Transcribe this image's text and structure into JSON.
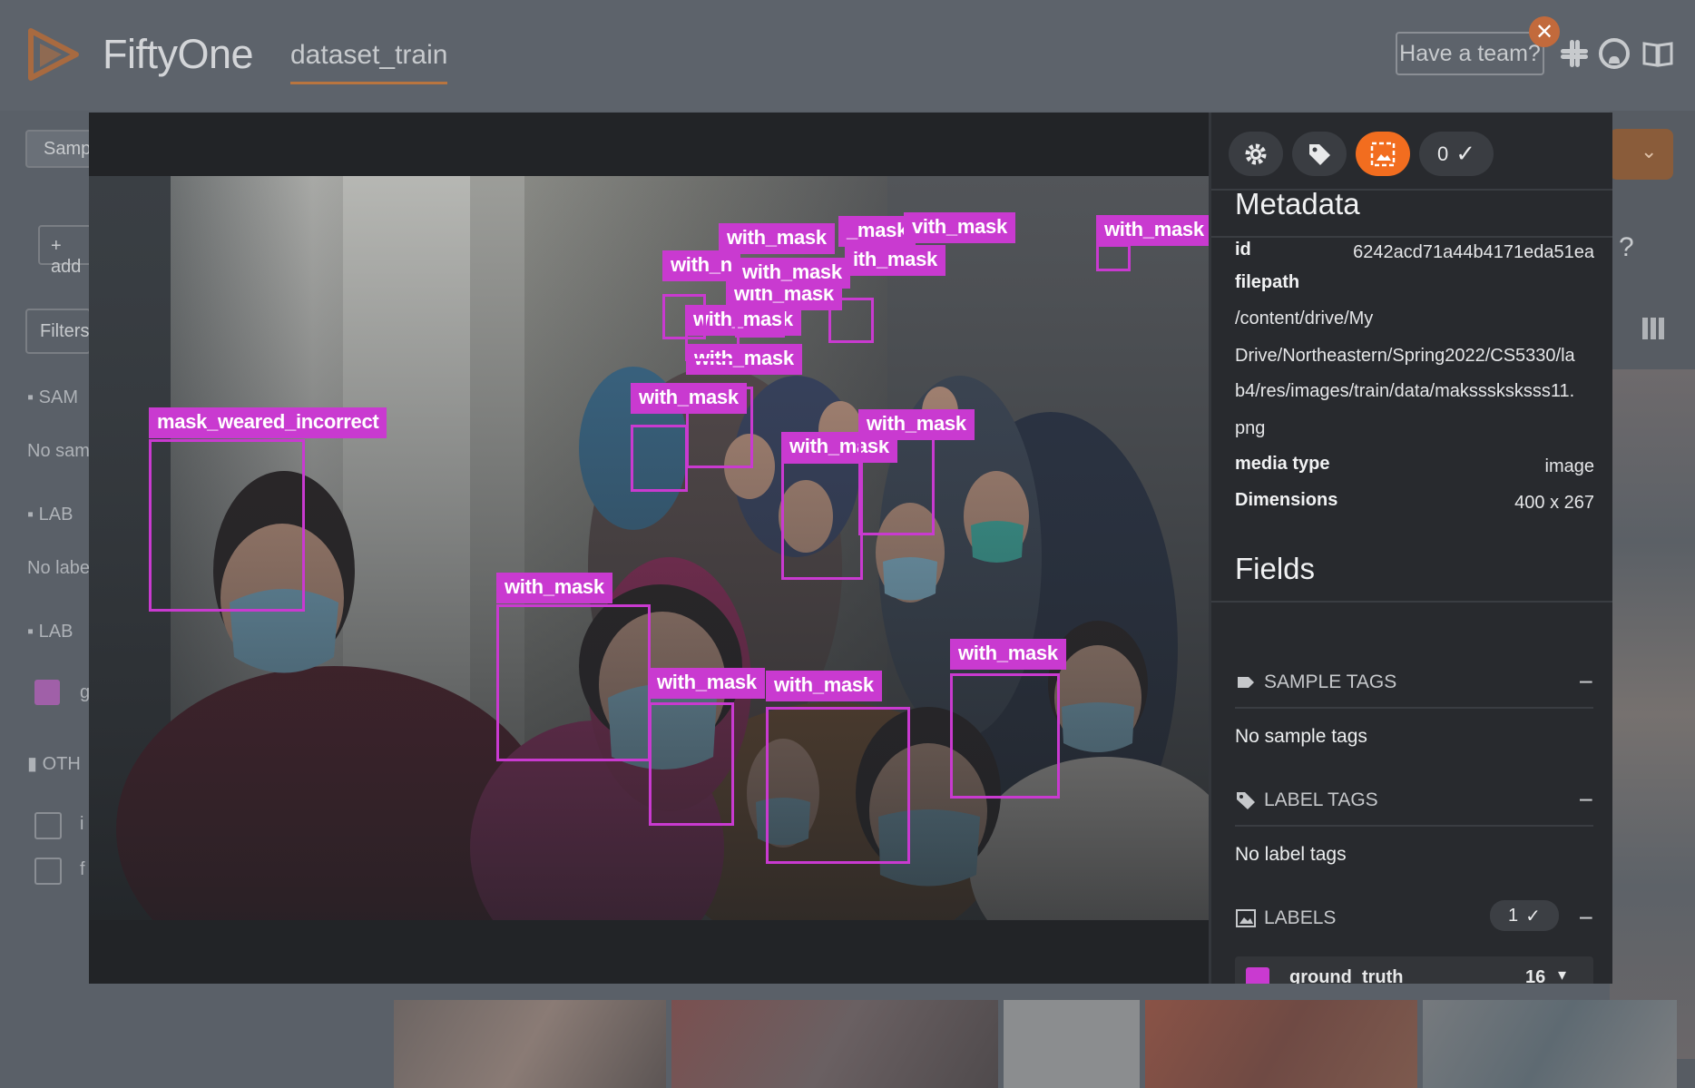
{
  "app": {
    "name": "FiftyOne",
    "dataset_tab": "dataset_train",
    "team_button": "Have a team?",
    "sidebar": {
      "samples_tab": "Samp",
      "add_stage": "+ add",
      "filters": "Filters",
      "sample_tags_header": "SAM",
      "no_sample_tags": "No sam",
      "label_tags_header": "LAB",
      "no_label_tags": "No labe",
      "labels_header": "LAB",
      "labels_item": "g",
      "other_header": "OTH",
      "other_item_1": "i",
      "other_item_2": "f"
    }
  },
  "modal": {
    "toolbar": {
      "settings_icon": "gear-icon",
      "tag_icon": "tag-icon",
      "labels_icon": "image-labels-icon",
      "selected_count": "0"
    },
    "detections": [
      {
        "label": "mask_weared_incorrect"
      },
      {
        "label": "with_mask"
      },
      {
        "label": "with_mask"
      },
      {
        "label": "with_mask"
      },
      {
        "label": "with_mask"
      },
      {
        "label": "with_mask"
      },
      {
        "label": "with_mask"
      },
      {
        "label": "with_mask"
      },
      {
        "label": "with_mask"
      },
      {
        "label": "with_mask"
      },
      {
        "label": "with_mask"
      },
      {
        "label": "with_mask"
      },
      {
        "label": "with_mask"
      },
      {
        "label": "with_n"
      },
      {
        "label": "with_mask"
      },
      {
        "label": "ith_mask"
      },
      {
        "label": "_mask"
      },
      {
        "label": "vith_mask"
      }
    ],
    "panel": {
      "metadata_title": "Metadata",
      "id_key": "id",
      "id_value": "6242acd71a44b4171eda51ea",
      "filepath_key": "filepath",
      "filepath_lines": [
        "/content/drive/My",
        "Drive/Northeastern/Spring2022/CS5330/la",
        "b4/res/images/train/data/maksssksksss11.",
        "png"
      ],
      "media_type_key": "media type",
      "media_type_value": "image",
      "dimensions_key": "Dimensions",
      "dimensions_value": "400 x 267",
      "fields_title": "Fields",
      "sample_tags_label": "SAMPLE TAGS",
      "no_sample_tags": "No sample tags",
      "label_tags_label": "LABEL TAGS",
      "no_label_tags": "No label tags",
      "labels_label": "LABELS",
      "labels_badge": "1",
      "ground_truth_label": "ground_truth",
      "ground_truth_count": "16",
      "collapse_symbol": "−"
    }
  },
  "colors": {
    "accent_orange": "#f26d1f",
    "bbox_magenta": "#c93ad0"
  }
}
